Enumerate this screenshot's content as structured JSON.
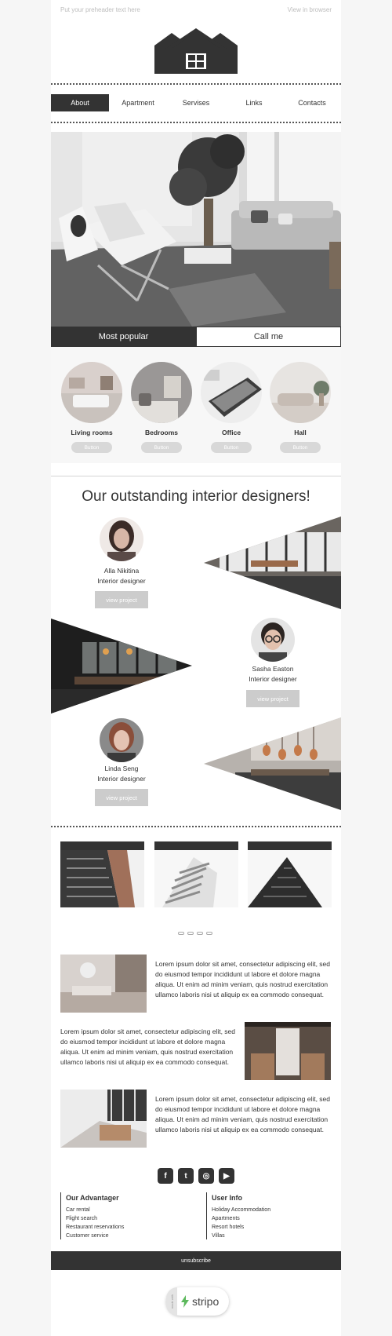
{
  "preheader": {
    "left_text": "Put your preheader text here",
    "right_text": "View in browser"
  },
  "nav": {
    "items": [
      "About",
      "Apartment",
      "Servises",
      "Links",
      "Contacts"
    ],
    "active_index": 0
  },
  "hero_tabs": {
    "left": "Most popular",
    "right": "Call me"
  },
  "categories": [
    {
      "label": "Living rooms",
      "button": "Button"
    },
    {
      "label": "Bedrooms",
      "button": "Button"
    },
    {
      "label": "Office",
      "button": "Button"
    },
    {
      "label": "Hall",
      "button": "Button"
    }
  ],
  "designers_section": {
    "title": "Our outstanding interior designers!",
    "designers": [
      {
        "name": "Alla Nikitina",
        "role": "Interior designer",
        "button": "view project"
      },
      {
        "name": "Sasha Easton",
        "role": "Interior designer",
        "button": "view project"
      },
      {
        "name": "Linda Seng",
        "role": "Interior designer",
        "button": "view project"
      }
    ]
  },
  "articles": [
    {
      "text": "Lorem ipsum dolor sit amet, consectetur adipiscing elit, sed do eiusmod tempor incididunt ut labore et dolore magna aliqua. Ut enim ad minim veniam, quis nostrud exercitation ullamco laboris nisi ut aliquip ex ea commodo consequat."
    },
    {
      "text": "Lorem ipsum dolor sit amet, consectetur adipiscing elit, sed do eiusmod tempor incididunt ut labore et dolore magna aliqua. Ut enim ad minim veniam, quis nostrud exercitation ullamco laboris nisi ut aliquip ex ea commodo consequat."
    },
    {
      "text": "Lorem ipsum dolor sit amet, consectetur adipiscing elit, sed do eiusmod tempor incididunt ut labore et dolore magna aliqua. Ut enim ad minim veniam, quis nostrud exercitation ullamco laboris nisi ut aliquip ex ea commodo consequat."
    }
  ],
  "social": {
    "icons": [
      "facebook-icon",
      "twitter-icon",
      "instagram-icon",
      "youtube-icon"
    ],
    "glyphs": [
      "f",
      "t",
      "◎",
      "▶"
    ]
  },
  "footer": {
    "col1": {
      "title": "Our Advantager",
      "items": [
        "Car rental",
        "Flight search",
        "Restaurant reservations",
        "Customer service"
      ]
    },
    "col2": {
      "title": "User Info",
      "items": [
        "Holiday Accommodation",
        "Apartments",
        "Resort hotels",
        "Villas"
      ]
    },
    "unsubscribe": "unsubscribe"
  },
  "badge": {
    "brand": "stripo",
    "side_text": "made with"
  },
  "colors": {
    "dark": "#333333",
    "pill": "#d8d8d8",
    "view_btn": "#cccccc",
    "brand_green": "#5cb85c",
    "page_bg": "#f6f6f6"
  }
}
